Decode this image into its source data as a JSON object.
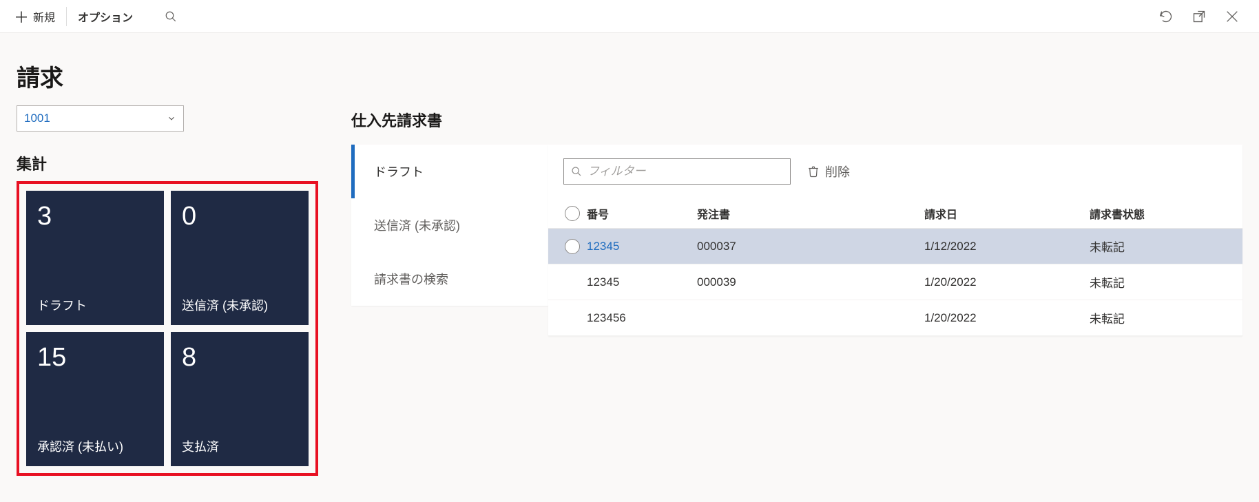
{
  "toolbar": {
    "new_label": "新規",
    "options_label": "オプション"
  },
  "page": {
    "title": "請求",
    "account_selected": "1001",
    "summary_title": "集計"
  },
  "tiles": [
    {
      "count": "3",
      "label": "ドラフト"
    },
    {
      "count": "0",
      "label": "送信済 (未承認)"
    },
    {
      "count": "15",
      "label": "承認済 (未払い)"
    },
    {
      "count": "8",
      "label": "支払済"
    }
  ],
  "list": {
    "title": "仕入先請求書",
    "tabs": [
      {
        "label": "ドラフト",
        "active": true
      },
      {
        "label": "送信済 (未承認)",
        "active": false
      },
      {
        "label": "請求書の検索",
        "active": false
      }
    ],
    "filter_placeholder": "フィルター",
    "delete_label": "削除",
    "columns": {
      "number": "番号",
      "po": "発注書",
      "date": "請求日",
      "status": "請求書状態"
    },
    "rows": [
      {
        "number": "12345",
        "po": "000037",
        "date": "1/12/2022",
        "status": "未転記",
        "selected": true
      },
      {
        "number": "12345",
        "po": "000039",
        "date": "1/20/2022",
        "status": "未転記",
        "selected": false
      },
      {
        "number": "123456",
        "po": "",
        "date": "1/20/2022",
        "status": "未転記",
        "selected": false
      }
    ]
  }
}
